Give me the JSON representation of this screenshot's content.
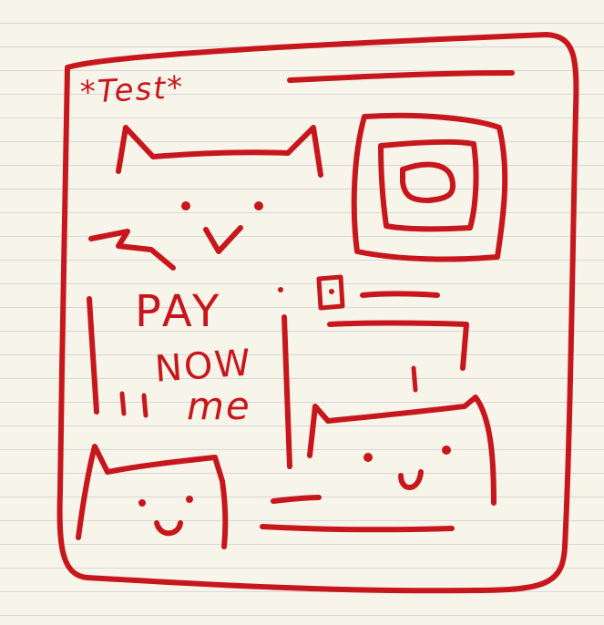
{
  "header": {
    "title": "*Test*"
  },
  "banner": {
    "line1": "PAY",
    "line2": "NOW",
    "line3": "me"
  },
  "colors": {
    "ink": "#c7161c",
    "paper": "#f7f4ea",
    "rule_lines": "#d7d7d7"
  }
}
